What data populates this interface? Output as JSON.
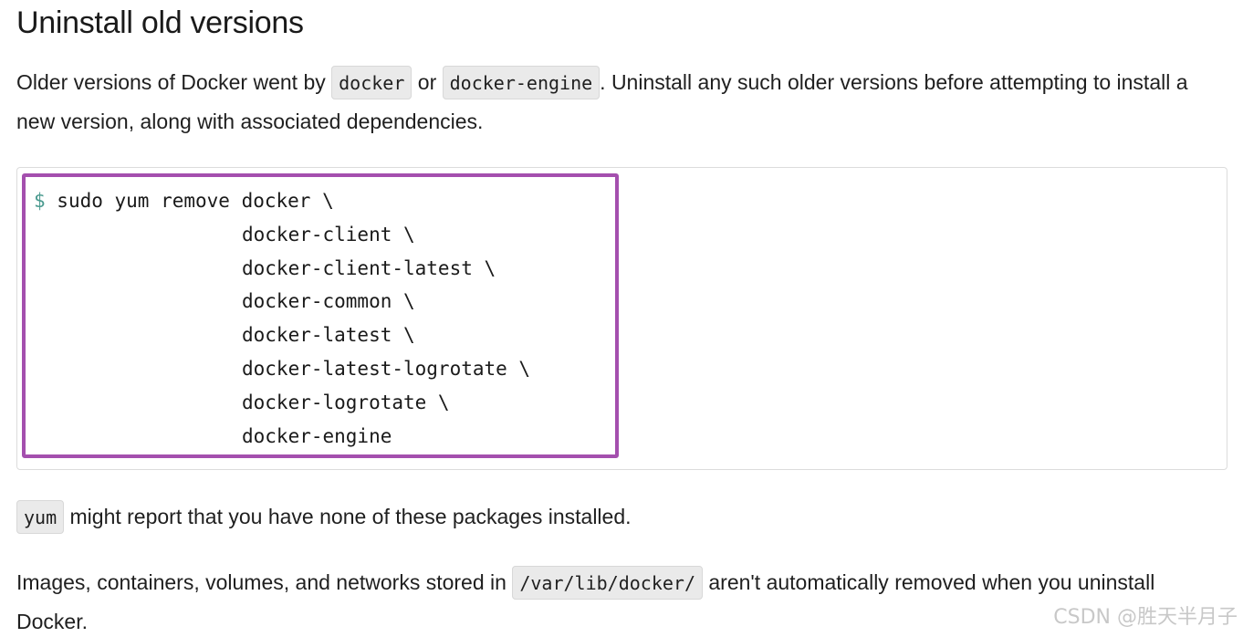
{
  "heading": "Uninstall old versions",
  "intro": {
    "text_before": "Older versions of Docker went by ",
    "code_docker": "docker",
    "text_or": " or ",
    "code_docker_engine": "docker-engine",
    "text_after": ". Uninstall any such older versions before attempting to install a new version, along with associated dependencies."
  },
  "code_block": {
    "prompt": "$",
    "first_line": " sudo yum remove docker \\",
    "continuation_lines": [
      "docker-client \\",
      "docker-client-latest \\",
      "docker-common \\",
      "docker-latest \\",
      "docker-latest-logrotate \\",
      "docker-logrotate \\",
      "docker-engine"
    ],
    "highlight_color": "#a44fae"
  },
  "note_yum": {
    "code": "yum",
    "text": " might report that you have none of these packages installed."
  },
  "note_storage": {
    "text_before": "Images, containers, volumes, and networks stored in ",
    "code_path": "/var/lib/docker/",
    "text_after": " aren't automatically removed when you uninstall Docker."
  },
  "watermark": "CSDN @胜天半月子"
}
